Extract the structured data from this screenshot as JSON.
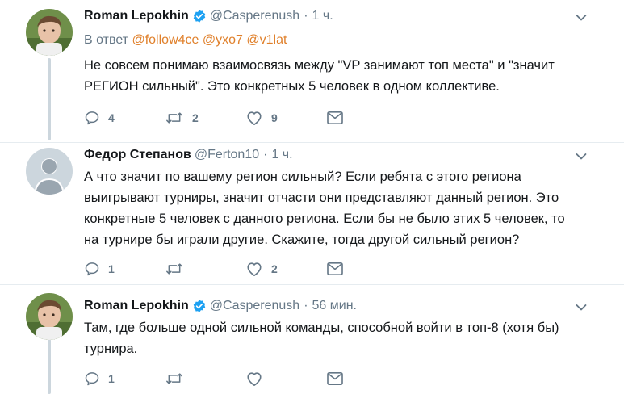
{
  "tweets": [
    {
      "author": "Roman Lepokhin",
      "verified": true,
      "handle": "@Casperenush",
      "separator": "·",
      "time": "1 ч.",
      "reply_prefix": "В ответ",
      "mentions": [
        "@follow4ce",
        "@yxo7",
        "@v1lat"
      ],
      "lines": [
        "Не совсем понимаю взаимосвязь между \"VP занимают топ места\" и \"значит",
        "РЕГИОН сильный\". Это конкретных 5 человек в одном коллективе."
      ],
      "replies": "4",
      "retweets": "2",
      "likes": "9"
    },
    {
      "author": "Федор Степанов",
      "verified": false,
      "handle": "@Ferton10",
      "separator": "·",
      "time": "1 ч.",
      "lines": [
        "А что значит по вашему регион сильный? Если ребята с этого региона",
        "выигрывают турниры, значит отчасти они представляют данный регион. Это",
        "конкретные 5 человек с данного региона. Если бы не было этих 5 человек, то",
        "на турнире бы играли другие. Скажите, тогда другой сильный регион?"
      ],
      "replies": "1",
      "retweets": "",
      "likes": "2"
    },
    {
      "author": "Roman Lepokhin",
      "verified": true,
      "handle": "@Casperenush",
      "separator": "·",
      "time": "56 мин.",
      "lines": [
        "Там, где больше одной сильной команды, способной войти в топ-8 (хотя бы)",
        "турнира."
      ],
      "replies": "1",
      "retweets": "",
      "likes": ""
    }
  ],
  "colors": {
    "text": "#14171a",
    "secondary": "#657786",
    "mention": "#e0802b",
    "verified": "#1da1f2",
    "thread_line": "#ccd6dd",
    "divider": "#e6ecf0"
  },
  "icons": [
    "chevron-down-icon",
    "verified-icon",
    "reply-icon",
    "retweet-icon",
    "like-icon",
    "message-icon"
  ]
}
